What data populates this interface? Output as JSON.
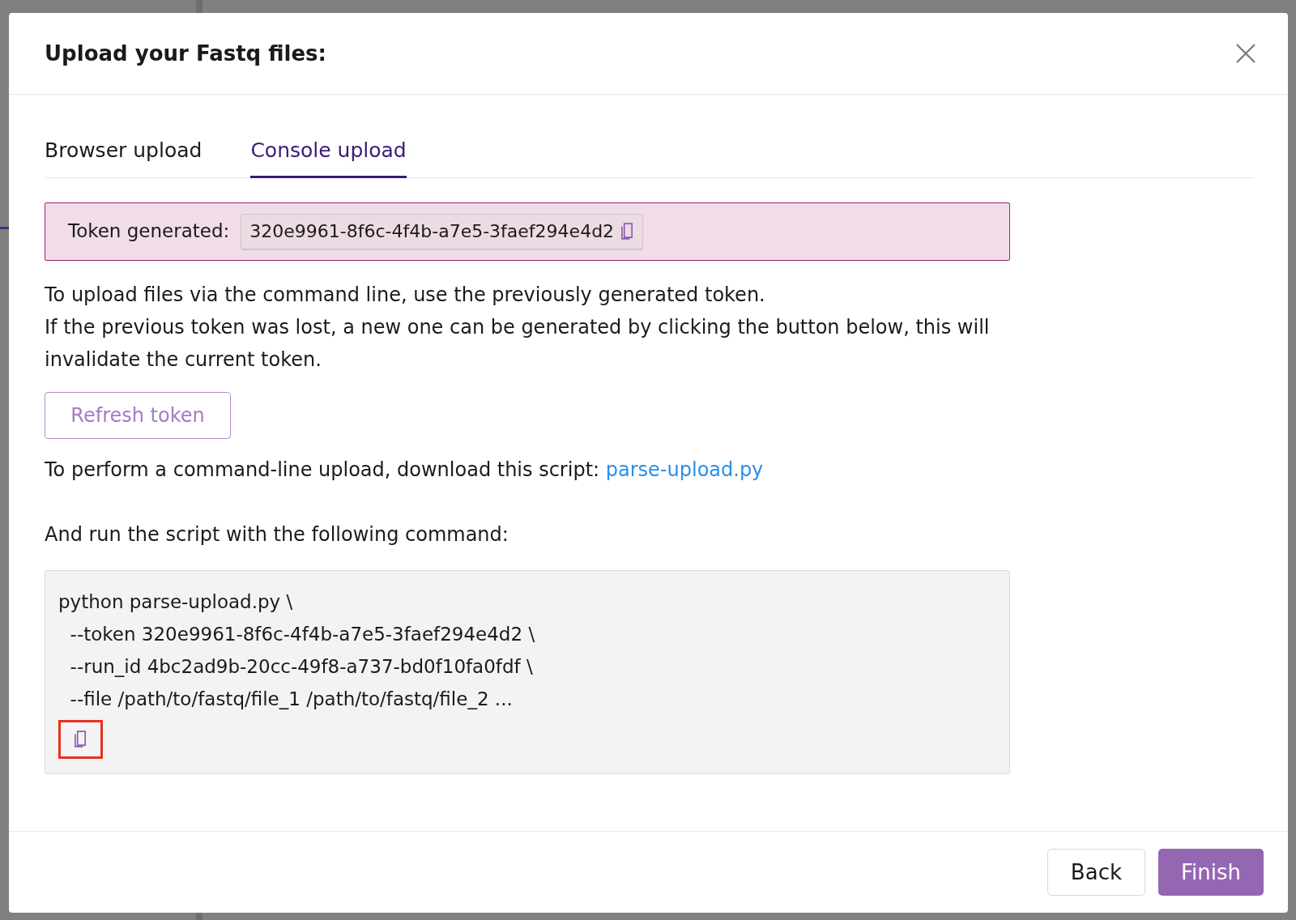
{
  "dialog": {
    "title": "Upload your Fastq files:"
  },
  "tabs": [
    {
      "label": "Browser upload",
      "selected": false
    },
    {
      "label": "Console upload",
      "selected": true
    }
  ],
  "token": {
    "label": "Token generated:",
    "value": "320e9961-8f6c-4f4b-a7e5-3faef294e4d2"
  },
  "instructions": [
    "To upload files via the command line, use the previously generated token.",
    "If the previous token was lost, a new one can be generated by clicking the button below, this will invalidate the current token."
  ],
  "refresh_button": "Refresh token",
  "download": {
    "text": "To perform a command-line upload, download this script:",
    "link": "parse-upload.py"
  },
  "command_intro": "And run the script with the following command:",
  "command_lines": [
    "python parse-upload.py \\",
    "  --token 320e9961-8f6c-4f4b-a7e5-3faef294e4d2 \\",
    "  --run_id 4bc2ad9b-20cc-49f8-a737-bd0f10fa0fdf \\",
    "  --file /path/to/fastq/file_1 /path/to/fastq/file_2 ..."
  ],
  "buttons": [
    {
      "label": "Back",
      "kind": "secondary"
    },
    {
      "label": "Finish",
      "kind": "primary"
    }
  ]
}
